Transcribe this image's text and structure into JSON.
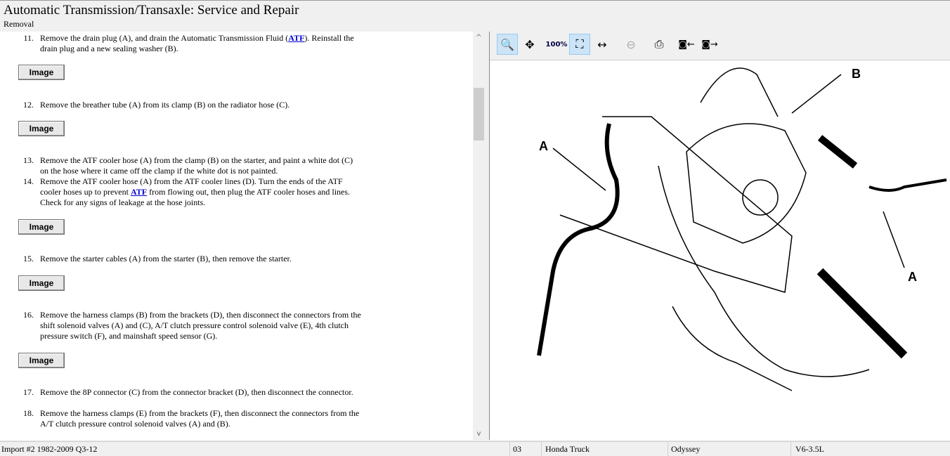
{
  "header": {
    "title": "Automatic Transmission/Transaxle:  Service and Repair",
    "subtitle": "Removal"
  },
  "steps": [
    {
      "n": "11.",
      "pre": "Remove the drain plug (A), and drain the Automatic Transmission Fluid (",
      "link": "ATF",
      "post": "). Reinstall the drain plug and a new sealing washer (B)."
    },
    {
      "n": "12.",
      "text": "Remove the breather tube (A) from its clamp (B) on the radiator hose (C)."
    },
    {
      "n": "13.",
      "text": "Remove the ATF cooler hose (A) from the clamp (B) on the starter, and paint a white dot (C) on the hose where it came off the clamp if the white dot is not painted."
    },
    {
      "n": "14.",
      "pre": "Remove the ATF cooler hose (A) from the ATF cooler lines (D). Turn the ends of the ATF cooler hoses up to prevent ",
      "link": "ATF",
      "post": " from flowing out, then plug the ATF cooler hoses and lines. Check for any signs of leakage at the hose joints."
    },
    {
      "n": "15.",
      "text": "Remove the starter cables (A) from the starter (B), then remove the starter."
    },
    {
      "n": "16.",
      "text": "Remove the harness clamps (B) from the brackets (D), then disconnect the connectors from the shift solenoid valves (A) and (C), A/T clutch pressure control solenoid valve (E), 4th clutch pressure switch (F), and mainshaft speed sensor (G)."
    },
    {
      "n": "17.",
      "text": "Remove the 8P connector (C) from the connector bracket (D), then disconnect the connector."
    },
    {
      "n": "18.",
      "text": "Remove the harness clamps (E) from the brackets (F), then disconnect the connectors from the A/T clutch pressure control solenoid valves (A) and (B)."
    }
  ],
  "image_button": "Image",
  "toolbar": [
    "zoom-in",
    "pan",
    "zoom-100",
    "zoom-fit",
    "zoom-width",
    "zoom-out",
    "print",
    "previous-image",
    "next-image"
  ],
  "diagram": {
    "labels": [
      "A",
      "B",
      "A"
    ]
  },
  "status": {
    "source": "Import #2 1982-2009 Q3-12",
    "year": "03",
    "make": "Honda Truck",
    "model": "Odyssey",
    "engine": "V6-3.5L"
  }
}
